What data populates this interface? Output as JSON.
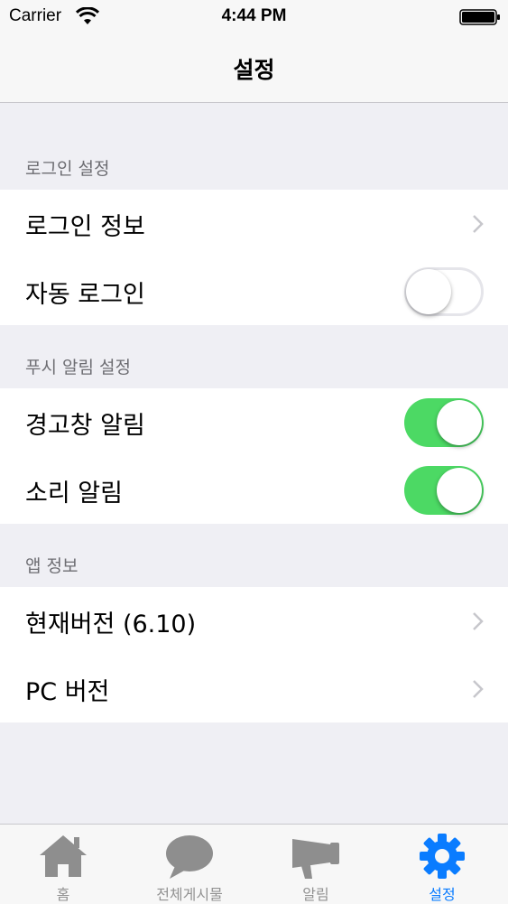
{
  "status_bar": {
    "carrier": "Carrier",
    "time": "4:44 PM"
  },
  "nav": {
    "title": "설정"
  },
  "sections": [
    {
      "header": "로그인 설정",
      "rows": [
        {
          "label": "로그인 정보",
          "accessory": "chevron"
        },
        {
          "label": "자동 로그인",
          "accessory": "toggle",
          "on": false
        }
      ]
    },
    {
      "header": "푸시 알림 설정",
      "rows": [
        {
          "label": "경고창 알림",
          "accessory": "toggle",
          "on": true
        },
        {
          "label": "소리 알림",
          "accessory": "toggle",
          "on": true
        }
      ]
    },
    {
      "header": "앱 정보",
      "rows": [
        {
          "label": "현재버전 (6.10)",
          "accessory": "chevron"
        },
        {
          "label": "PC 버전",
          "accessory": "chevron"
        }
      ]
    }
  ],
  "tabs": [
    {
      "label": "홈",
      "icon": "home-icon",
      "active": false
    },
    {
      "label": "전체게시물",
      "icon": "speech-bubble-icon",
      "active": false
    },
    {
      "label": "알림",
      "icon": "megaphone-icon",
      "active": false
    },
    {
      "label": "설정",
      "icon": "gear-icon",
      "active": true
    }
  ],
  "colors": {
    "toggle_on": "#4cd964",
    "active_tab": "#0a7cff",
    "inactive_tab": "#929292",
    "background": "#efeff4"
  }
}
